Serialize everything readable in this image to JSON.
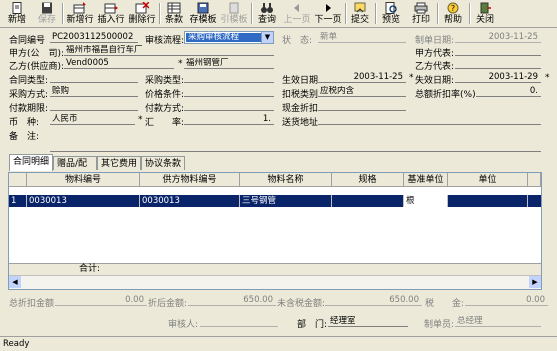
{
  "toolbar": {
    "items": [
      {
        "label": "新增",
        "icon": "new-document-icon",
        "enabled": true
      },
      {
        "label": "保存",
        "icon": "save-disk-icon",
        "enabled": false
      },
      {
        "label": "新增行",
        "icon": "add-row-icon",
        "enabled": true
      },
      {
        "label": "插入行",
        "icon": "insert-row-icon",
        "enabled": true
      },
      {
        "label": "删除行",
        "icon": "delete-row-icon",
        "enabled": true
      },
      {
        "label": "条款",
        "icon": "terms-grid-icon",
        "enabled": true
      },
      {
        "label": "存模板",
        "icon": "template-save-icon",
        "enabled": true
      },
      {
        "label": "引模板",
        "icon": "template-load-icon",
        "enabled": false
      },
      {
        "label": "查询",
        "icon": "binoculars-icon",
        "enabled": true
      },
      {
        "label": "上一页",
        "icon": "prev-arrow-icon",
        "enabled": false
      },
      {
        "label": "下一页",
        "icon": "next-arrow-icon",
        "enabled": true
      },
      {
        "label": "提交",
        "icon": "submit-icon",
        "enabled": true
      },
      {
        "label": "预览",
        "icon": "preview-icon",
        "enabled": true
      },
      {
        "label": "打印",
        "icon": "printer-icon",
        "enabled": true
      },
      {
        "label": "帮助",
        "icon": "help-icon",
        "enabled": true
      },
      {
        "label": "关闭",
        "icon": "exit-door-icon",
        "enabled": true
      }
    ]
  },
  "form": {
    "contract_no_label": "合同编号",
    "contract_no": "PC2003112500002",
    "flow_label": "审核流程:",
    "flow_value": "采购审核流程",
    "status_label": "状　态:",
    "status_value": "新单",
    "made_date_label": "制单日期:",
    "made_date": "2003-11-25",
    "party_a_label": "甲方(公　司):",
    "party_a": "福州市福昌自行车厂",
    "party_a_rep_label": "甲方代表:",
    "party_b_label": "乙方(供应商):",
    "party_b_code": "Vend0005",
    "party_b_name": "福州钢管厂",
    "party_b_rep_label": "乙方代表:",
    "contract_type_label": "合同类型:",
    "purchase_type_label": "采购类型:",
    "effective_date_label": "生效日期:",
    "effective_date": "2003-11-25",
    "expire_date_label": "失效日期:",
    "expire_date": "2003-11-29",
    "purchase_method_label": "采购方式:",
    "purchase_method": "赊购",
    "price_terms_label": "价格条件:",
    "deduction_type_label": "扣税类别:",
    "deduction_type": "应税内含",
    "discount_label": "总额折扣率(%):",
    "discount_value": "0.",
    "payment_term_label": "付款期限:",
    "payment_method_label": "付款方式:",
    "cash_discount_label": "现金折扣:",
    "currency_label": "币　种:",
    "currency": "人民币",
    "rate_label": "汇　　率:",
    "rate_value": "1.",
    "delivery_addr_label": "送货地址:",
    "remark_label": "备　注:"
  },
  "tabs": [
    {
      "label": "合同明细",
      "active": true
    },
    {
      "label": "赠品/配件",
      "active": false
    },
    {
      "label": "其它费用",
      "active": false
    },
    {
      "label": "协议条款",
      "active": false
    }
  ],
  "grid": {
    "columns": [
      "物料编号",
      "供方物料编号",
      "物料名称",
      "规格",
      "基准单位",
      "单位"
    ],
    "rows": [
      {
        "no": "1",
        "material_no": "0030013",
        "vendor_material_no": "0030013",
        "name": "三号钢管",
        "spec": "",
        "base_unit": "根",
        "unit": ""
      }
    ],
    "total_label": "合计:"
  },
  "summary": {
    "total_discount_label": "总折扣金额:",
    "total_discount": "0.00",
    "after_discount_label": "折后金额:",
    "after_discount": "650.00",
    "untaxed_label": "未含税金额:",
    "untaxed": "650.00",
    "tax_label": "税　　金:",
    "tax": "0.00"
  },
  "footer": {
    "auditor_label": "审核人:",
    "dept_label": "部　门:",
    "dept": "经理室",
    "maker_label": "制单员:",
    "maker": "总经理"
  },
  "statusbar": {
    "text": "Ready"
  },
  "colors": {
    "selected_row": "#0a246a",
    "face": "#ece9d8"
  }
}
